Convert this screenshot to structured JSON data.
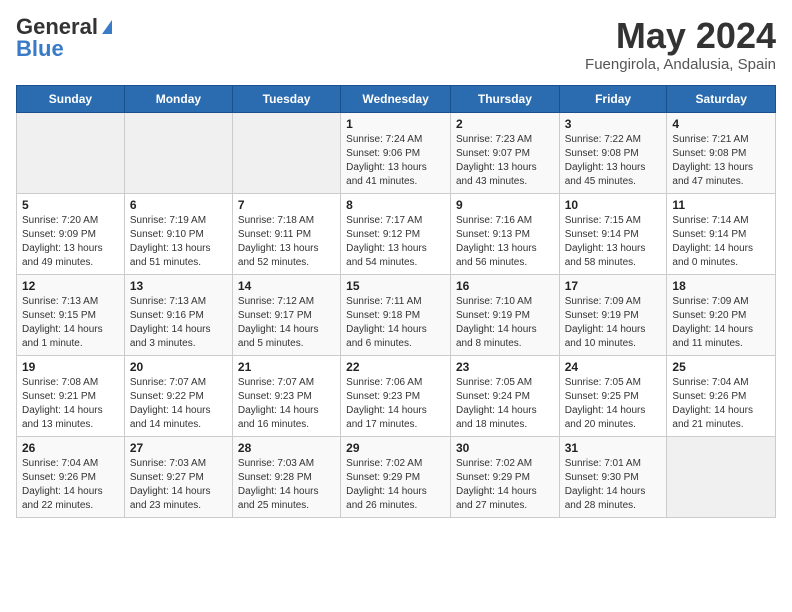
{
  "header": {
    "logo_general": "General",
    "logo_blue": "Blue",
    "month_year": "May 2024",
    "location": "Fuengirola, Andalusia, Spain"
  },
  "days_of_week": [
    "Sunday",
    "Monday",
    "Tuesday",
    "Wednesday",
    "Thursday",
    "Friday",
    "Saturday"
  ],
  "weeks": [
    [
      {
        "day": "",
        "empty": true
      },
      {
        "day": "",
        "empty": true
      },
      {
        "day": "",
        "empty": true
      },
      {
        "day": "1",
        "sunrise": "7:24 AM",
        "sunset": "9:06 PM",
        "daylight": "13 hours and 41 minutes."
      },
      {
        "day": "2",
        "sunrise": "7:23 AM",
        "sunset": "9:07 PM",
        "daylight": "13 hours and 43 minutes."
      },
      {
        "day": "3",
        "sunrise": "7:22 AM",
        "sunset": "9:08 PM",
        "daylight": "13 hours and 45 minutes."
      },
      {
        "day": "4",
        "sunrise": "7:21 AM",
        "sunset": "9:08 PM",
        "daylight": "13 hours and 47 minutes."
      }
    ],
    [
      {
        "day": "5",
        "sunrise": "7:20 AM",
        "sunset": "9:09 PM",
        "daylight": "13 hours and 49 minutes."
      },
      {
        "day": "6",
        "sunrise": "7:19 AM",
        "sunset": "9:10 PM",
        "daylight": "13 hours and 51 minutes."
      },
      {
        "day": "7",
        "sunrise": "7:18 AM",
        "sunset": "9:11 PM",
        "daylight": "13 hours and 52 minutes."
      },
      {
        "day": "8",
        "sunrise": "7:17 AM",
        "sunset": "9:12 PM",
        "daylight": "13 hours and 54 minutes."
      },
      {
        "day": "9",
        "sunrise": "7:16 AM",
        "sunset": "9:13 PM",
        "daylight": "13 hours and 56 minutes."
      },
      {
        "day": "10",
        "sunrise": "7:15 AM",
        "sunset": "9:14 PM",
        "daylight": "13 hours and 58 minutes."
      },
      {
        "day": "11",
        "sunrise": "7:14 AM",
        "sunset": "9:14 PM",
        "daylight": "14 hours and 0 minutes."
      }
    ],
    [
      {
        "day": "12",
        "sunrise": "7:13 AM",
        "sunset": "9:15 PM",
        "daylight": "14 hours and 1 minute."
      },
      {
        "day": "13",
        "sunrise": "7:13 AM",
        "sunset": "9:16 PM",
        "daylight": "14 hours and 3 minutes."
      },
      {
        "day": "14",
        "sunrise": "7:12 AM",
        "sunset": "9:17 PM",
        "daylight": "14 hours and 5 minutes."
      },
      {
        "day": "15",
        "sunrise": "7:11 AM",
        "sunset": "9:18 PM",
        "daylight": "14 hours and 6 minutes."
      },
      {
        "day": "16",
        "sunrise": "7:10 AM",
        "sunset": "9:19 PM",
        "daylight": "14 hours and 8 minutes."
      },
      {
        "day": "17",
        "sunrise": "7:09 AM",
        "sunset": "9:19 PM",
        "daylight": "14 hours and 10 minutes."
      },
      {
        "day": "18",
        "sunrise": "7:09 AM",
        "sunset": "9:20 PM",
        "daylight": "14 hours and 11 minutes."
      }
    ],
    [
      {
        "day": "19",
        "sunrise": "7:08 AM",
        "sunset": "9:21 PM",
        "daylight": "14 hours and 13 minutes."
      },
      {
        "day": "20",
        "sunrise": "7:07 AM",
        "sunset": "9:22 PM",
        "daylight": "14 hours and 14 minutes."
      },
      {
        "day": "21",
        "sunrise": "7:07 AM",
        "sunset": "9:23 PM",
        "daylight": "14 hours and 16 minutes."
      },
      {
        "day": "22",
        "sunrise": "7:06 AM",
        "sunset": "9:23 PM",
        "daylight": "14 hours and 17 minutes."
      },
      {
        "day": "23",
        "sunrise": "7:05 AM",
        "sunset": "9:24 PM",
        "daylight": "14 hours and 18 minutes."
      },
      {
        "day": "24",
        "sunrise": "7:05 AM",
        "sunset": "9:25 PM",
        "daylight": "14 hours and 20 minutes."
      },
      {
        "day": "25",
        "sunrise": "7:04 AM",
        "sunset": "9:26 PM",
        "daylight": "14 hours and 21 minutes."
      }
    ],
    [
      {
        "day": "26",
        "sunrise": "7:04 AM",
        "sunset": "9:26 PM",
        "daylight": "14 hours and 22 minutes."
      },
      {
        "day": "27",
        "sunrise": "7:03 AM",
        "sunset": "9:27 PM",
        "daylight": "14 hours and 23 minutes."
      },
      {
        "day": "28",
        "sunrise": "7:03 AM",
        "sunset": "9:28 PM",
        "daylight": "14 hours and 25 minutes."
      },
      {
        "day": "29",
        "sunrise": "7:02 AM",
        "sunset": "9:29 PM",
        "daylight": "14 hours and 26 minutes."
      },
      {
        "day": "30",
        "sunrise": "7:02 AM",
        "sunset": "9:29 PM",
        "daylight": "14 hours and 27 minutes."
      },
      {
        "day": "31",
        "sunrise": "7:01 AM",
        "sunset": "9:30 PM",
        "daylight": "14 hours and 28 minutes."
      },
      {
        "day": "",
        "empty": true
      }
    ]
  ]
}
